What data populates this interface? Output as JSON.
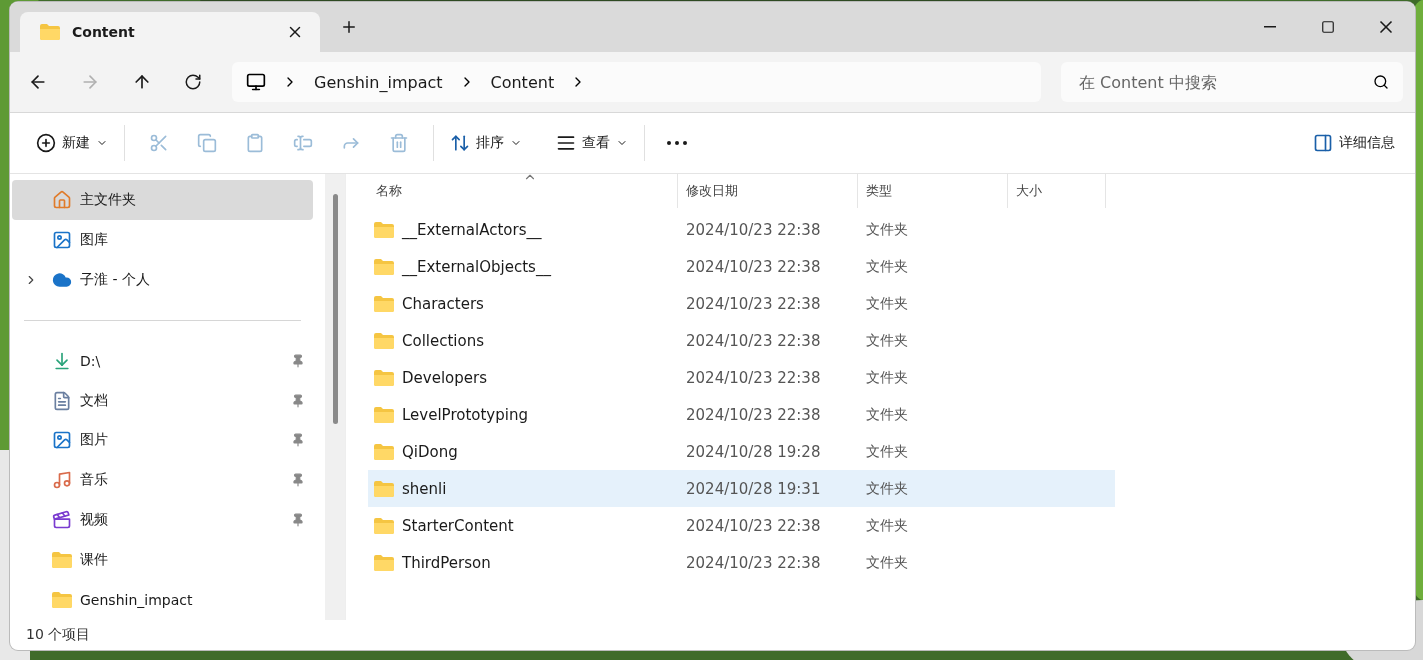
{
  "tab": {
    "title": "Content"
  },
  "address": {
    "crumbs": [
      "Genshin_impact",
      "Content"
    ],
    "search_placeholder": "在 Content 中搜索"
  },
  "toolbar": {
    "new": "新建",
    "sort": "排序",
    "view": "查看",
    "details": "详细信息",
    "actions": [
      {
        "kind": "cut",
        "disabled": true
      },
      {
        "kind": "copy",
        "disabled": true
      },
      {
        "kind": "paste",
        "disabled": true
      },
      {
        "kind": "rename",
        "disabled": true
      },
      {
        "kind": "share",
        "disabled": true
      },
      {
        "kind": "delete",
        "disabled": true
      }
    ]
  },
  "sidebar": {
    "items": [
      {
        "kind": "home",
        "label": "主文件夹",
        "selected": true,
        "expandable": false,
        "pinned": false
      },
      {
        "kind": "gallery",
        "label": "图库",
        "selected": false,
        "expandable": false,
        "pinned": false
      },
      {
        "kind": "cloud",
        "label": "子淮 - 个人",
        "selected": false,
        "expandable": true,
        "pinned": false
      },
      {
        "kind": "divider"
      },
      {
        "kind": "download",
        "label": "D:\\",
        "selected": false,
        "expandable": false,
        "pinned": true
      },
      {
        "kind": "document",
        "label": "文档",
        "selected": false,
        "expandable": false,
        "pinned": true
      },
      {
        "kind": "pictures",
        "label": "图片",
        "selected": false,
        "expandable": false,
        "pinned": true
      },
      {
        "kind": "music",
        "label": "音乐",
        "selected": false,
        "expandable": false,
        "pinned": true
      },
      {
        "kind": "video",
        "label": "视频",
        "selected": false,
        "expandable": false,
        "pinned": true
      },
      {
        "kind": "folder",
        "label": "课件",
        "selected": false,
        "expandable": false,
        "pinned": false
      },
      {
        "kind": "folder",
        "label": "Genshin_impact",
        "selected": false,
        "expandable": false,
        "pinned": false
      }
    ]
  },
  "table": {
    "columns": [
      {
        "label": "名称",
        "sorted": true
      },
      {
        "label": "修改日期",
        "sorted": false
      },
      {
        "label": "类型",
        "sorted": false
      },
      {
        "label": "大小",
        "sorted": false
      }
    ],
    "rows": [
      {
        "name": "__ExternalActors__",
        "modified": "2024/10/23 22:38",
        "type": "文件夹",
        "selected": false
      },
      {
        "name": "__ExternalObjects__",
        "modified": "2024/10/23 22:38",
        "type": "文件夹",
        "selected": false
      },
      {
        "name": "Characters",
        "modified": "2024/10/23 22:38",
        "type": "文件夹",
        "selected": false
      },
      {
        "name": "Collections",
        "modified": "2024/10/23 22:38",
        "type": "文件夹",
        "selected": false
      },
      {
        "name": "Developers",
        "modified": "2024/10/23 22:38",
        "type": "文件夹",
        "selected": false
      },
      {
        "name": "LevelPrototyping",
        "modified": "2024/10/23 22:38",
        "type": "文件夹",
        "selected": false
      },
      {
        "name": "QiDong",
        "modified": "2024/10/28 19:28",
        "type": "文件夹",
        "selected": false
      },
      {
        "name": "shenli",
        "modified": "2024/10/28 19:31",
        "type": "文件夹",
        "selected": true
      },
      {
        "name": "StarterContent",
        "modified": "2024/10/23 22:38",
        "type": "文件夹",
        "selected": false
      },
      {
        "name": "ThirdPerson",
        "modified": "2024/10/23 22:38",
        "type": "文件夹",
        "selected": false
      }
    ]
  },
  "status_bar": {
    "count": "10 个项目"
  }
}
